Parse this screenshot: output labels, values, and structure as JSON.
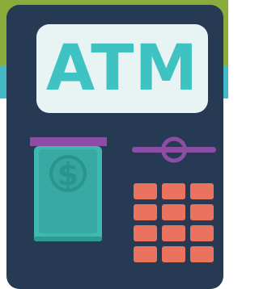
{
  "screen": {
    "text": "ATM"
  },
  "icons": {
    "banknote": "dollar-bill-icon",
    "card_slot": "card-slot-icon"
  },
  "keypad": {
    "rows": 4,
    "columns": 3
  },
  "colors": {
    "background_top": "#8aac3a",
    "background_band": "#43b9c7",
    "background_bottom": "#ffffff",
    "machine_body": "#263a53",
    "screen": "#e8f4f4",
    "screen_text": "#3ec2c2",
    "slot": "#8c4ea5",
    "banknote": "#3fb8b0",
    "keys": "#e9735f"
  }
}
